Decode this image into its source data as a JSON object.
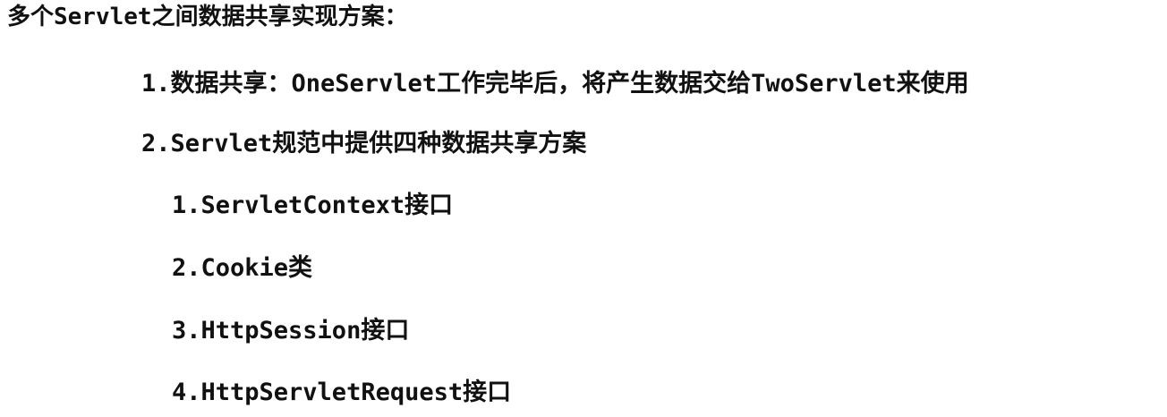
{
  "title": "多个Servlet之间数据共享实现方案：",
  "points": [
    "1.数据共享：OneServlet工作完毕后，将产生数据交给TwoServlet来使用",
    "2.Servlet规范中提供四种数据共享方案"
  ],
  "schemes": [
    "1.ServletContext接口",
    "2.Cookie类",
    "3.HttpSession接口",
    "4.HttpServletRequest接口"
  ]
}
